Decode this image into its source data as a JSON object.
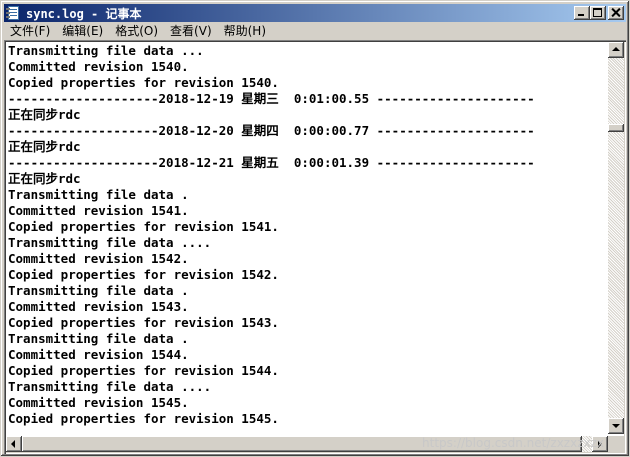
{
  "window": {
    "title": "sync.log - 记事本"
  },
  "menu": [
    {
      "label": "文件(F)"
    },
    {
      "label": "编辑(E)"
    },
    {
      "label": "格式(O)"
    },
    {
      "label": "查看(V)"
    },
    {
      "label": "帮助(H)"
    }
  ],
  "lines": [
    "Transmitting file data ...",
    "Committed revision 1540.",
    "Copied properties for revision 1540.",
    "--------------------2018-12-19 星期三  0:01:00.55 ---------------------",
    "正在同步rdc",
    "--------------------2018-12-20 星期四  0:00:00.77 ---------------------",
    "正在同步rdc",
    "--------------------2018-12-21 星期五  0:00:01.39 ---------------------",
    "正在同步rdc",
    "Transmitting file data .",
    "Committed revision 1541.",
    "Copied properties for revision 1541.",
    "Transmitting file data ....",
    "Committed revision 1542.",
    "Copied properties for revision 1542.",
    "Transmitting file data .",
    "Committed revision 1543.",
    "Copied properties for revision 1543.",
    "Transmitting file data .",
    "Committed revision 1544.",
    "Copied properties for revision 1544.",
    "Transmitting file data ....",
    "Committed revision 1545.",
    "Copied properties for revision 1545."
  ],
  "watermark": "https://blog.csdn.net/zxzxzxzx",
  "icons": {
    "app": "notepad-icon",
    "minimize": "minimize-icon",
    "maximize": "maximize-icon",
    "close": "close-icon"
  },
  "colors": {
    "titlebar_start": "#0a246a",
    "titlebar_end": "#a6caf0",
    "chrome": "#d4d0c8",
    "text": "#000000"
  }
}
